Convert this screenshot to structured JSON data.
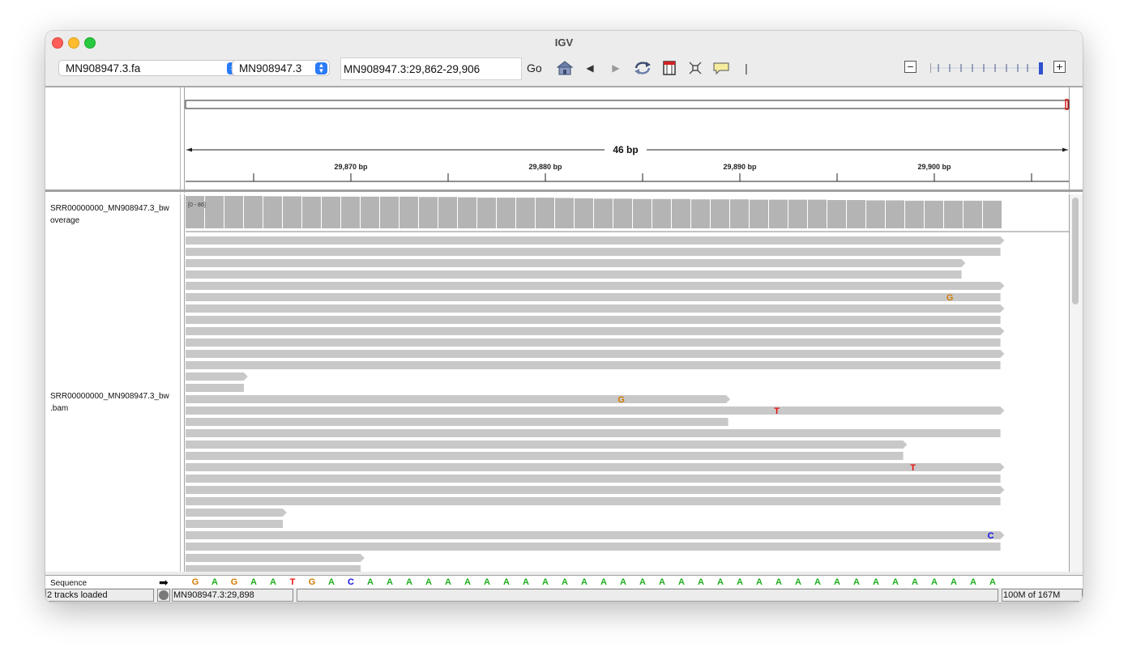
{
  "window": {
    "title": "IGV"
  },
  "toolbar": {
    "genome": "MN908947.3.fa",
    "chromosome": "MN908947.3",
    "locus": "MN908947.3:29,862-29,906",
    "go_label": "Go",
    "icons": [
      "home-icon",
      "back-icon",
      "forward-icon",
      "refresh-icon",
      "ruler-icon",
      "fit-window-icon",
      "popup-text-icon"
    ]
  },
  "ruler": {
    "span_label": "46 bp",
    "ticks": [
      {
        "label": "29,870 bp",
        "pos": 29870
      },
      {
        "label": "29,880 bp",
        "pos": 29880
      },
      {
        "label": "29,890 bp",
        "pos": 29890
      },
      {
        "label": "29,900 bp",
        "pos": 29900
      }
    ],
    "start": 29861.5,
    "end": 29906.5
  },
  "tracks": {
    "coverage_label_line1": "SRR00000000_MN908947.3_bw",
    "coverage_label_line2": "overage",
    "coverage_range": "[0 - 86]",
    "alignment_label_line1": "SRR00000000_MN908947.3_bw",
    "alignment_label_line2": ".bam",
    "coverage_values": [
      86,
      86,
      86,
      86,
      85,
      85,
      84,
      84,
      84,
      84,
      84,
      84,
      83,
      83,
      82,
      81,
      81,
      81,
      81,
      80,
      79,
      78,
      78,
      77,
      77,
      77,
      76,
      76,
      76,
      75,
      75,
      75,
      75,
      74,
      74,
      73,
      73,
      72,
      72,
      72,
      72,
      72,
      71,
      71,
      70,
      70,
      69,
      68,
      68,
      67,
      67,
      66,
      66,
      65,
      65,
      64,
      64,
      63,
      63,
      62
    ]
  },
  "reads": [
    {
      "start": 0,
      "end": 42.1,
      "arrow": true
    },
    {
      "start": 0,
      "end": 41.9,
      "arrow": false
    },
    {
      "start": 0,
      "end": 40.1,
      "arrow": true
    },
    {
      "start": 0,
      "end": 39.9,
      "arrow": false
    },
    {
      "start": 0,
      "end": 42.1,
      "arrow": true
    },
    {
      "start": 0,
      "end": 41.9,
      "arrow": false,
      "mismatch": {
        "pos": 39.3,
        "base": "G"
      }
    },
    {
      "start": 0,
      "end": 42.1,
      "arrow": true
    },
    {
      "start": 0,
      "end": 41.9,
      "arrow": false
    },
    {
      "start": 0,
      "end": 42.1,
      "arrow": true
    },
    {
      "start": 0,
      "end": 41.9,
      "arrow": false
    },
    {
      "start": 0,
      "end": 42.1,
      "arrow": true
    },
    {
      "start": 0,
      "end": 41.9,
      "arrow": false
    },
    {
      "start": 0,
      "end": 3.2,
      "arrow": true
    },
    {
      "start": 0,
      "end": 3.0,
      "arrow": false
    },
    {
      "start": 0,
      "end": 28.0,
      "arrow": true,
      "mismatch": {
        "pos": 22.4,
        "base": "G"
      }
    },
    {
      "start": 0,
      "end": 42.1,
      "arrow": true,
      "mismatch": {
        "pos": 30.4,
        "base": "T"
      }
    },
    {
      "start": 0,
      "end": 27.9,
      "arrow": false
    },
    {
      "start": 0,
      "end": 41.9,
      "arrow": false
    },
    {
      "start": 0,
      "end": 37.1,
      "arrow": true
    },
    {
      "start": 0,
      "end": 36.9,
      "arrow": false
    },
    {
      "start": 0,
      "end": 42.1,
      "arrow": true,
      "mismatch": {
        "pos": 37.4,
        "base": "T"
      }
    },
    {
      "start": 0,
      "end": 41.9,
      "arrow": false
    },
    {
      "start": 0,
      "end": 42.1,
      "arrow": true
    },
    {
      "start": 0,
      "end": 41.9,
      "arrow": false
    },
    {
      "start": 0,
      "end": 5.2,
      "arrow": true
    },
    {
      "start": 0,
      "end": 5.0,
      "arrow": false
    },
    {
      "start": 0,
      "end": 42.1,
      "arrow": true,
      "mismatch": {
        "pos": 41.4,
        "base": "C"
      }
    },
    {
      "start": 0,
      "end": 41.9,
      "arrow": false
    },
    {
      "start": 0,
      "end": 9.2,
      "arrow": true
    },
    {
      "start": 0,
      "end": 9.0,
      "arrow": false
    }
  ],
  "sequence": {
    "label": "Sequence",
    "bases": [
      "G",
      "A",
      "G",
      "A",
      "A",
      "T",
      "G",
      "A",
      "C",
      "A",
      "A",
      "A",
      "A",
      "A",
      "A",
      "A",
      "A",
      "A",
      "A",
      "A",
      "A",
      "A",
      "A",
      "A",
      "A",
      "A",
      "A",
      "A",
      "A",
      "A",
      "A",
      "A",
      "A",
      "A",
      "A",
      "A",
      "A",
      "A",
      "A",
      "A",
      "A",
      "A"
    ],
    "colors": {
      "A": "#1fae1f",
      "C": "#1010e8",
      "G": "#d17a00",
      "T": "#e81010"
    }
  },
  "status": {
    "tracks_loaded": "2 tracks loaded",
    "position": "MN908947.3:29,898",
    "memory": "100M of 167M"
  }
}
